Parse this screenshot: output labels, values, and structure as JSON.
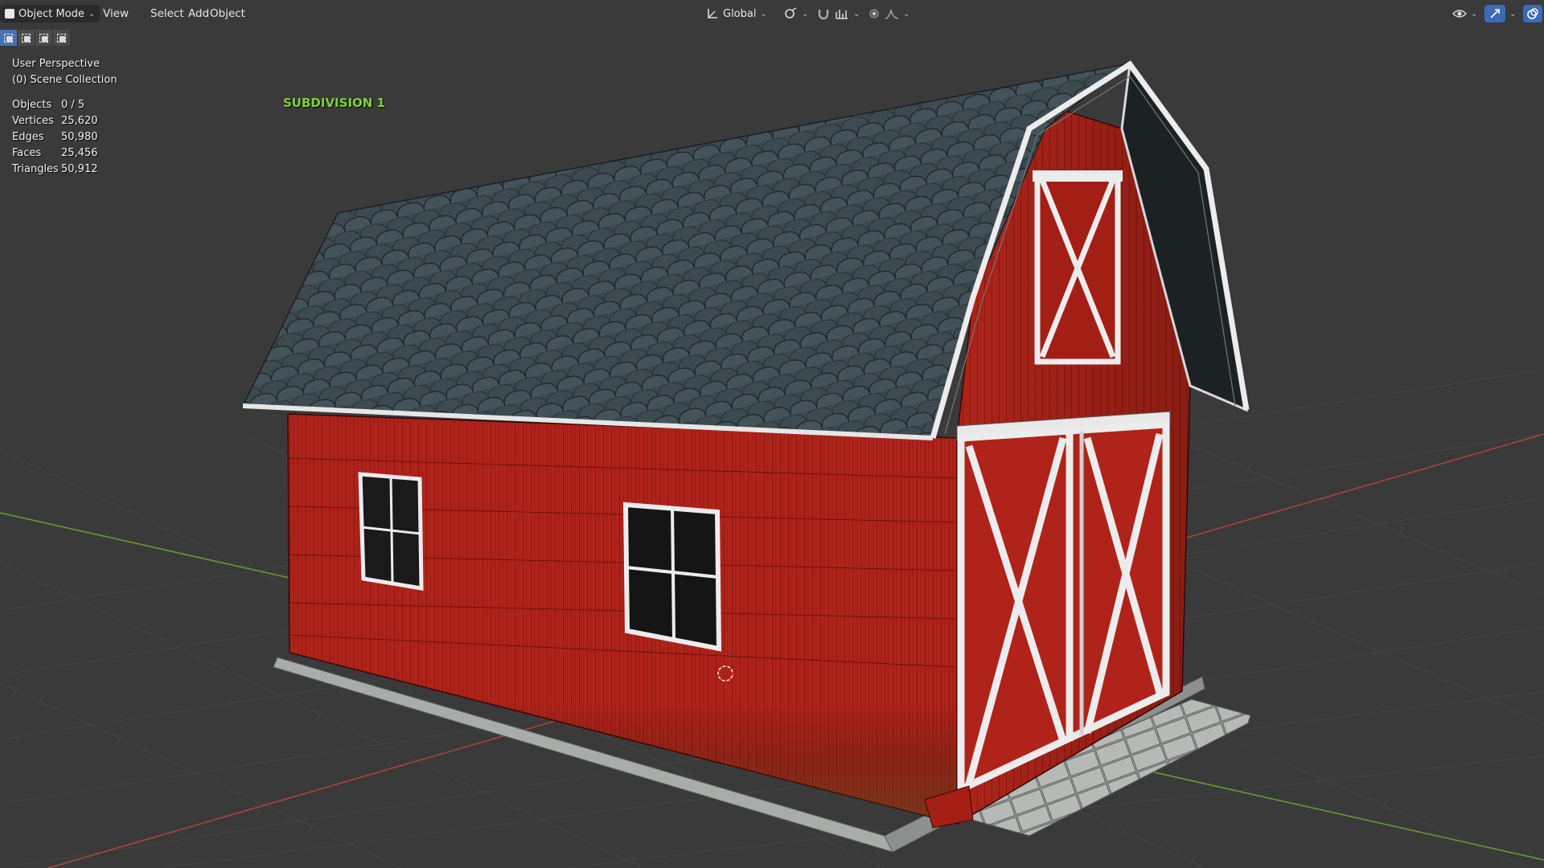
{
  "header": {
    "mode_label": "Object Mode",
    "menus": [
      "View",
      "Select",
      "Add",
      "Object"
    ],
    "orientation_label": "Global"
  },
  "selection_modes": [
    "set",
    "extend",
    "subtract",
    "intersect"
  ],
  "overlay": {
    "perspective": "User Perspective",
    "collection": "(0) Scene Collection",
    "subdivision": "SUBDIVISION 1"
  },
  "stats": [
    {
      "label": "Objects",
      "value": "0 / 5"
    },
    {
      "label": "Vertices",
      "value": "25,620"
    },
    {
      "label": "Edges",
      "value": "50,980"
    },
    {
      "label": "Faces",
      "value": "25,456"
    },
    {
      "label": "Triangles",
      "value": "50,912"
    }
  ],
  "colors": {
    "viewport_bg": "#3a3a3a",
    "grid": "#454545",
    "x_axis": "#b34a4a",
    "y_axis": "#6f9a3a",
    "barn_red": "#b52319",
    "roof": "#3f4d52",
    "trim": "#e8e8e8",
    "subdivision_text": "#7fd13b",
    "active_button": "#4772b3"
  },
  "icons": {
    "mode": "object-mode-icon",
    "transform_orientation": "transform-axes-icon",
    "pivot": "pivot-icon",
    "snap": "magnet-snap-icon",
    "proportional": "proportional-edit-icon",
    "visibility": "eye-visibility-icon",
    "gizmo": "gizmo-icon",
    "overlays": "overlays-icon"
  }
}
